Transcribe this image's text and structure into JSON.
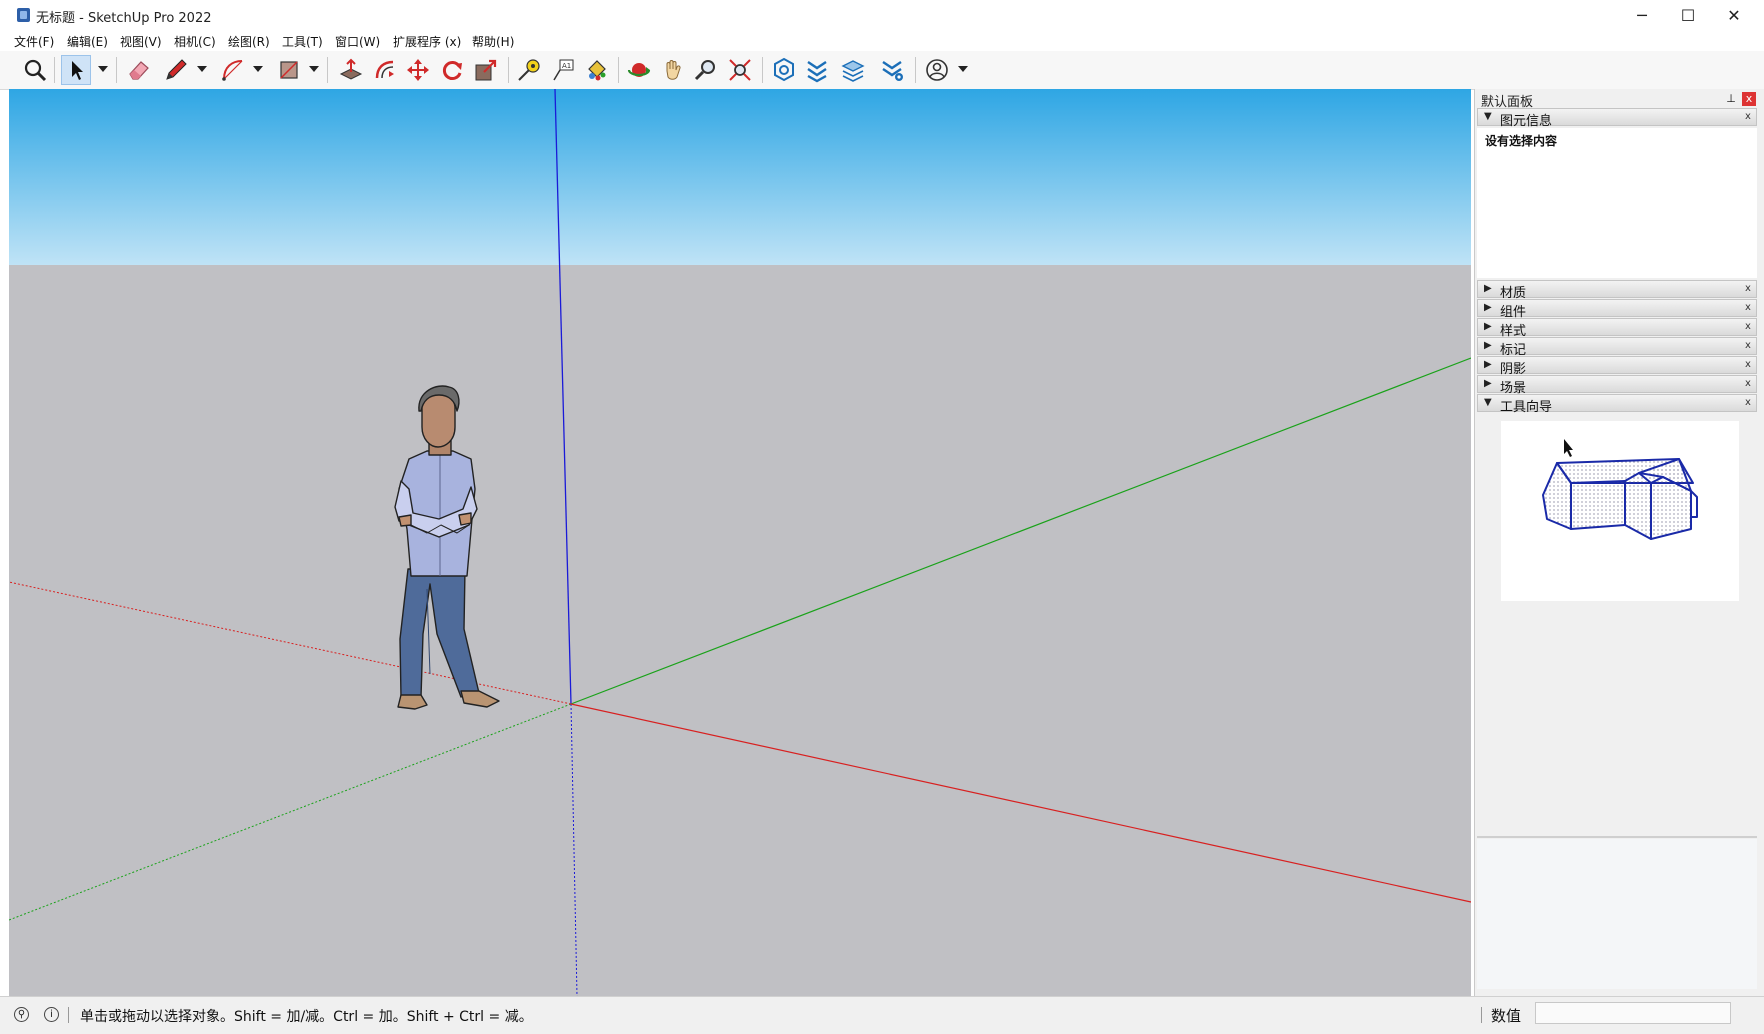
{
  "window": {
    "title": "无标题 - SketchUp Pro 2022",
    "minimize_glyph": "─",
    "maximize_glyph": "☐",
    "close_glyph": "✕"
  },
  "menu": [
    "文件(F)",
    "编辑(E)",
    "视图(V)",
    "相机(C)",
    "绘图(R)",
    "工具(T)",
    "窗口(W)",
    "扩展程序 (x)",
    "帮助(H)"
  ],
  "toolbar": {
    "tools": [
      "search-icon",
      "select-arrow-icon",
      "eraser-icon",
      "pencil-line-icon",
      "arc-icon",
      "rectangle-icon",
      "push-pull-icon",
      "offset-icon",
      "move-icon",
      "rotate-icon",
      "scale-icon",
      "tape-measure-icon",
      "text-label-icon",
      "paint-bucket-icon",
      "orbit-icon",
      "pan-hand-icon",
      "zoom-icon",
      "zoom-extents-icon",
      "3d-warehouse-icon",
      "extension-warehouse-icon",
      "layout-icon",
      "extension-manager-icon",
      "account-icon"
    ]
  },
  "tray": {
    "title": "默认面板",
    "pin_glyph": "⊥",
    "close_glyph": "x",
    "panels": [
      {
        "label": "图元信息",
        "expanded": true
      },
      {
        "label": "材质",
        "expanded": false
      },
      {
        "label": "组件",
        "expanded": false
      },
      {
        "label": "样式",
        "expanded": false
      },
      {
        "label": "标记",
        "expanded": false
      },
      {
        "label": "阴影",
        "expanded": false
      },
      {
        "label": "场景",
        "expanded": false
      },
      {
        "label": "工具向导",
        "expanded": true
      }
    ],
    "entity_info_empty": "设有选择内容",
    "expanded_arrow": "▼",
    "collapsed_arrow": "▶",
    "panel_close_glyph": "x"
  },
  "status": {
    "message": "单击或拖动以选择对象。Shift = 加/减。Ctrl = 加。Shift + Ctrl = 减。",
    "geo_icon_glyph": "⚲",
    "info_icon_glyph": "i",
    "measurements_label": "数值",
    "measurements_value": ""
  },
  "colors": {
    "sky_top": "#2ea6e4",
    "sky_bottom": "#bfe3f6",
    "ground": "#c0c0c4",
    "red_axis": "#d82020",
    "green_axis": "#1aa21a",
    "blue_axis": "#1a1ad8"
  }
}
